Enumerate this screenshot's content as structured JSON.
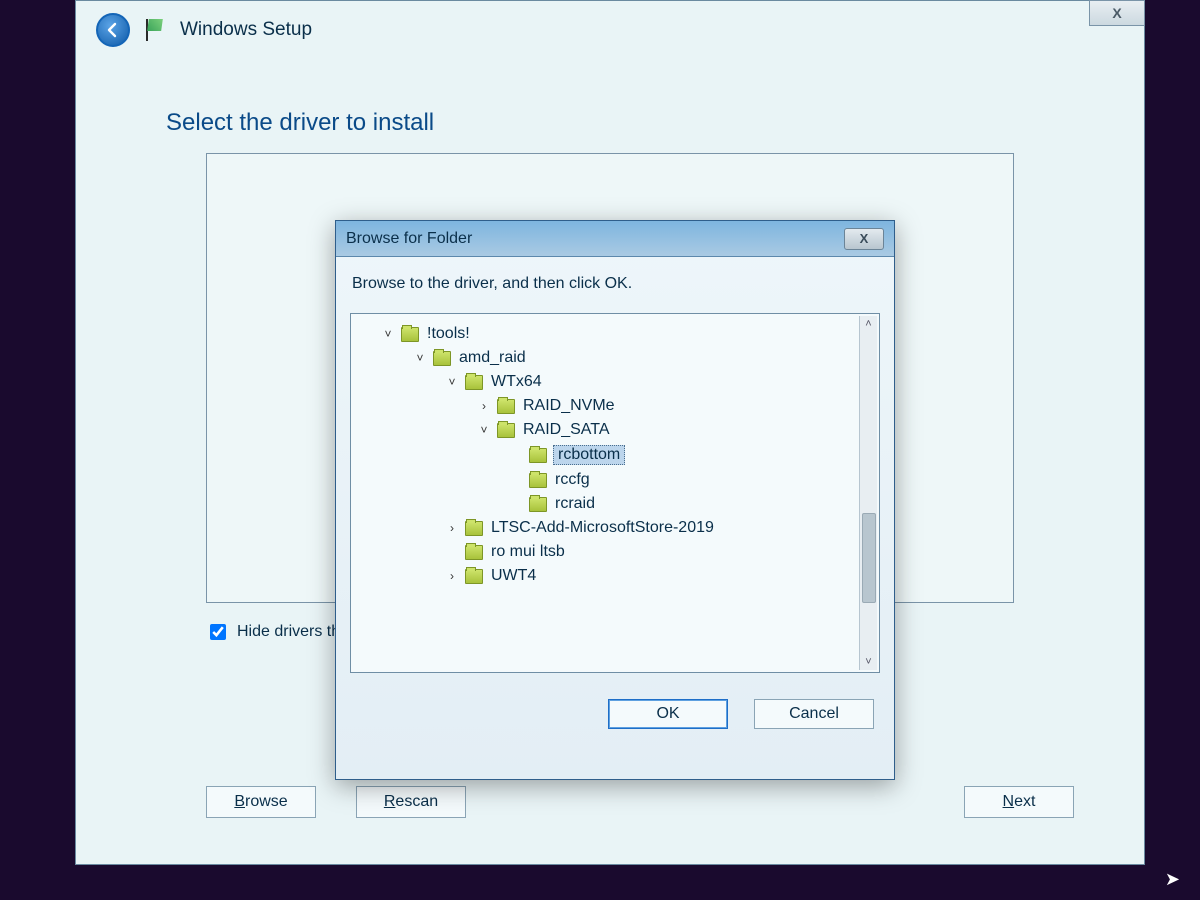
{
  "window": {
    "title": "Windows Setup",
    "close_glyph": "X"
  },
  "page": {
    "title": "Select the driver to install",
    "hide_label": "Hide drivers that",
    "hide_checked": true,
    "buttons": {
      "browse": "Browse",
      "rescan": "Rescan",
      "next": "Next"
    }
  },
  "browse": {
    "title": "Browse for Folder",
    "close_glyph": "X",
    "instruction": "Browse to the driver, and then click OK.",
    "buttons": {
      "ok": "OK",
      "cancel": "Cancel"
    },
    "tree": [
      {
        "label": "!tools!",
        "depth": 0,
        "chevron": "down"
      },
      {
        "label": "amd_raid",
        "depth": 1,
        "chevron": "down"
      },
      {
        "label": "WTx64",
        "depth": 2,
        "chevron": "down"
      },
      {
        "label": "RAID_NVMe",
        "depth": 3,
        "chevron": "right"
      },
      {
        "label": "RAID_SATA",
        "depth": 3,
        "chevron": "down"
      },
      {
        "label": "rcbottom",
        "depth": 4,
        "chevron": "",
        "selected": true
      },
      {
        "label": "rccfg",
        "depth": 4,
        "chevron": ""
      },
      {
        "label": "rcraid",
        "depth": 4,
        "chevron": ""
      },
      {
        "label": "LTSC-Add-MicrosoftStore-2019",
        "depth": 2,
        "chevron": "right"
      },
      {
        "label": "ro mui ltsb",
        "depth": 2,
        "chevron": ""
      },
      {
        "label": "UWT4",
        "depth": 2,
        "chevron": "right"
      }
    ]
  }
}
